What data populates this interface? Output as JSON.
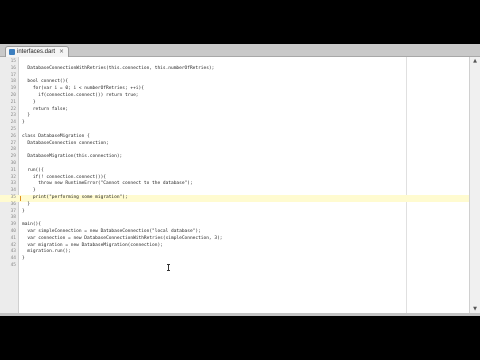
{
  "tab": {
    "label": "interfaces.dart",
    "close": "×"
  },
  "scroll": {
    "up": "▲",
    "down": "▼"
  },
  "code_lines": [
    {
      "n": "15",
      "text": ""
    },
    {
      "n": "16",
      "text": "  DatabaseConnectionWithRetries(this.connection, this.numberOfRetries);"
    },
    {
      "n": "17",
      "text": ""
    },
    {
      "n": "18",
      "text": "  bool connect(){"
    },
    {
      "n": "19",
      "text": "    for(var i = 0; i < numberOfRetries; ++i){"
    },
    {
      "n": "20",
      "text": "      if(connection.connect()) return true;"
    },
    {
      "n": "21",
      "text": "    }"
    },
    {
      "n": "22",
      "text": "    return false;"
    },
    {
      "n": "23",
      "text": "  }"
    },
    {
      "n": "24",
      "text": "}"
    },
    {
      "n": "25",
      "text": ""
    },
    {
      "n": "26",
      "text": "class DatabaseMigration {"
    },
    {
      "n": "27",
      "text": "  DatabaseConnection connection;"
    },
    {
      "n": "28",
      "text": ""
    },
    {
      "n": "29",
      "text": "  DatabaseMigration(this.connection);"
    },
    {
      "n": "30",
      "text": ""
    },
    {
      "n": "31",
      "text": "  run(){"
    },
    {
      "n": "32",
      "text": "    if(! connection.connect()){"
    },
    {
      "n": "33",
      "text": "      throw new RuntimeError(\"Cannot connect to the database\");"
    },
    {
      "n": "34",
      "text": "    }"
    },
    {
      "n": "35",
      "text": "    print(\"performing some migration\");"
    },
    {
      "n": "36",
      "text": "  }"
    },
    {
      "n": "37",
      "text": "}"
    },
    {
      "n": "38",
      "text": ""
    },
    {
      "n": "39",
      "text": "main(){"
    },
    {
      "n": "40",
      "text": "  var simpleConnection = new DatabaseConnection(\"local database\");"
    },
    {
      "n": "41",
      "text": "  var connection = new DatabaseConnectionWithRetries(simpleConnection, 3);"
    },
    {
      "n": "42",
      "text": "  var migration = new DatabaseMigration(connection);"
    },
    {
      "n": "43",
      "text": "  migration.run();"
    },
    {
      "n": "44",
      "text": "}"
    },
    {
      "n": "45",
      "text": ""
    }
  ]
}
